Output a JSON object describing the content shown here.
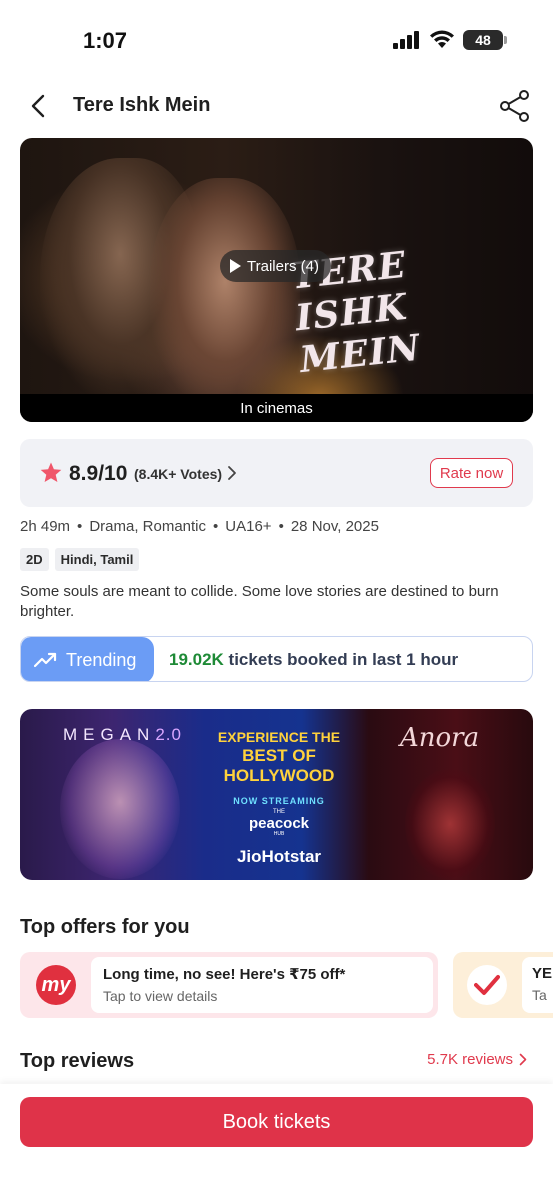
{
  "status_bar": {
    "time": "1:07",
    "battery": "48"
  },
  "header": {
    "title": "Tere Ishk Mein"
  },
  "poster": {
    "logo_text": "TERE ISHK MEIN",
    "trailers_label": "Trailers (4)",
    "in_cinemas_label": "In cinemas"
  },
  "rating": {
    "score": "8.9/10",
    "votes": "(8.4K+ Votes)",
    "rate_label": "Rate now"
  },
  "meta": {
    "duration": "2h 49m",
    "genres": "Drama, Romantic",
    "certificate": "UA16+",
    "release_date": "28 Nov, 2025",
    "separator": "•"
  },
  "chips": [
    "2D",
    "Hindi, Tamil"
  ],
  "description": "Some souls are meant to collide. Some love stories are destined to burn brighter.",
  "trending": {
    "label": "Trending",
    "count": "19.02K",
    "text": " tickets booked in last 1 hour"
  },
  "promo": {
    "megan": "MEGAN",
    "megan_version": "2.0",
    "experience": "EXPERIENCE THE",
    "best": "BEST OF HOLLYWOOD",
    "streaming": "NOW STREAMING",
    "peacock_the": "THE",
    "peacock": "peacock",
    "peacock_hub": "HUB",
    "jiohotstar": "JioHotstar",
    "anora": "Anora"
  },
  "offers": {
    "title": "Top offers for you",
    "items": [
      {
        "icon": "my",
        "headline": "Long time, no see! Here's ₹75 off*",
        "sub": "Tap to view details"
      },
      {
        "headline": "YE",
        "sub": "Ta"
      }
    ]
  },
  "reviews": {
    "title": "Top reviews",
    "count_label": "5.7K reviews"
  },
  "cta": {
    "book_label": "Book tickets"
  },
  "colors": {
    "accent": "#df3349",
    "trending_blue": "#6b9cf5",
    "trending_green": "#1e8a36"
  }
}
